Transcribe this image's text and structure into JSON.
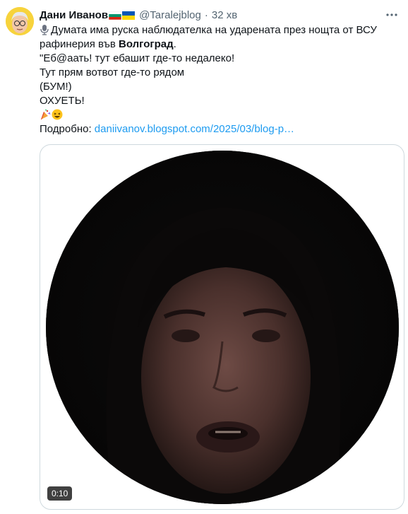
{
  "author": {
    "name": "Дани Иванов",
    "handle": "@Taralejblog",
    "separator": "·",
    "time": "32 хв",
    "avatar_color": "#f7d33c",
    "flags": [
      "bulgaria-flag-icon",
      "ukraine-flag-icon"
    ]
  },
  "more_icon": "more-dots-icon",
  "tweet": {
    "line1": "Думата има руска наблюдателка на ударената през нощта от ВСУ",
    "line2_prefix": "рафинерия във ",
    "line2_bold": "Волгоград",
    "line2_suffix": ".",
    "line3": "\"Еб@аать! тут ебашит где-то недалеко!",
    "line4": "Тут прям вотвот где-то рядом",
    "line5": "(БУМ!)",
    "line6": "ОХУЕТЬ!",
    "emojis": [
      "party-popper-icon",
      "laughing-face-icon"
    ],
    "link_prefix": "Подробно: ",
    "link_text": "daniivanov.blogspot.com/2025/03/blog-p…",
    "link_color": "#1d9bf0"
  },
  "media": {
    "type": "circular-video",
    "duration": "0:10"
  }
}
